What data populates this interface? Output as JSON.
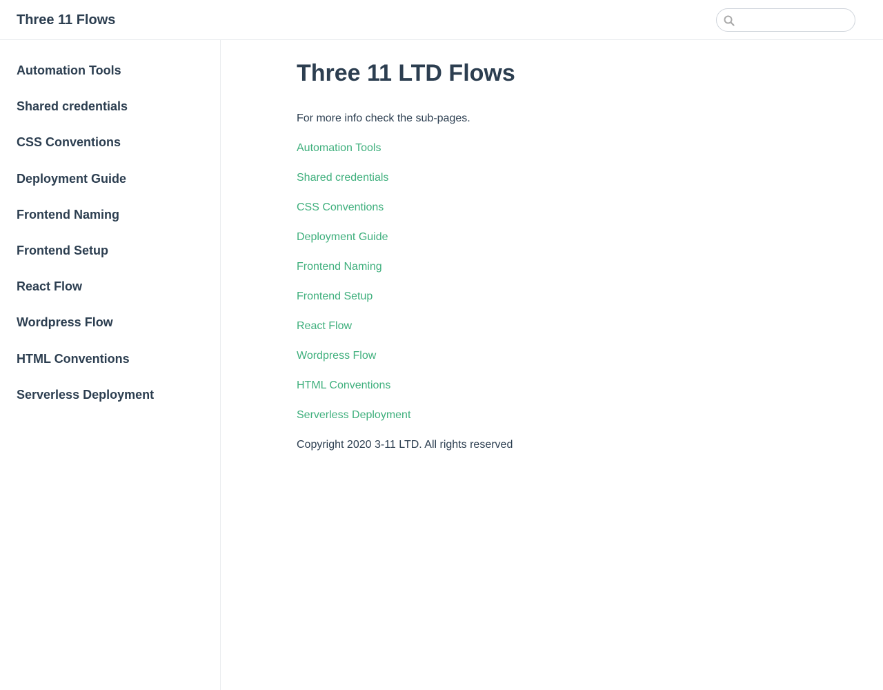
{
  "header": {
    "site_name": "Three 11 Flows",
    "search": {
      "icon": "search-icon",
      "value": "",
      "placeholder": ""
    }
  },
  "sidebar": {
    "items": [
      {
        "label": "Automation Tools"
      },
      {
        "label": "Shared credentials"
      },
      {
        "label": "CSS Conventions"
      },
      {
        "label": "Deployment Guide"
      },
      {
        "label": "Frontend Naming"
      },
      {
        "label": "Frontend Setup"
      },
      {
        "label": "React Flow"
      },
      {
        "label": "Wordpress Flow"
      },
      {
        "label": "HTML Conventions"
      },
      {
        "label": "Serverless Deployment"
      }
    ]
  },
  "main": {
    "title": "Three 11 LTD Flows",
    "intro": "For more info check the sub-pages.",
    "links": [
      {
        "label": "Automation Tools"
      },
      {
        "label": "Shared credentials"
      },
      {
        "label": "CSS Conventions"
      },
      {
        "label": "Deployment Guide"
      },
      {
        "label": "Frontend Naming"
      },
      {
        "label": "Frontend Setup"
      },
      {
        "label": "React Flow"
      },
      {
        "label": "Wordpress Flow"
      },
      {
        "label": "HTML Conventions"
      },
      {
        "label": "Serverless Deployment"
      }
    ],
    "copyright": "Copyright 2020 3-11 LTD. All rights reserved"
  },
  "colors": {
    "text": "#2c3e50",
    "accent": "#3eaf7c",
    "border": "#eaecef"
  }
}
